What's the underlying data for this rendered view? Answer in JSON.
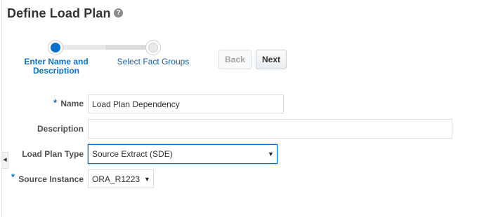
{
  "page": {
    "title": "Define Load Plan",
    "help_icon": "question-circle-icon",
    "help_glyph": "?"
  },
  "train": {
    "steps": [
      {
        "label": "Enter Name and Description",
        "state": "current"
      },
      {
        "label": "Select Fact Groups",
        "state": "next"
      }
    ]
  },
  "buttons": {
    "back_label": "Back",
    "next_label": "Next",
    "back_enabled": false
  },
  "form": {
    "required_marker": "*",
    "name": {
      "label": "Name",
      "value": "Load Plan Dependency",
      "required": true
    },
    "description": {
      "label": "Description",
      "value": ""
    },
    "load_plan_type": {
      "label": "Load Plan Type",
      "value": "Source Extract (SDE)"
    },
    "source_instance": {
      "label": "Source Instance",
      "value": "ORA_R1223",
      "required": true
    }
  },
  "icons": {
    "dropdown": "▼",
    "collapse_handle": "◀"
  },
  "colors": {
    "accent": "#0572ce",
    "link": "#145c9e",
    "label": "#4f4f4f",
    "border": "#d6dfe6"
  }
}
